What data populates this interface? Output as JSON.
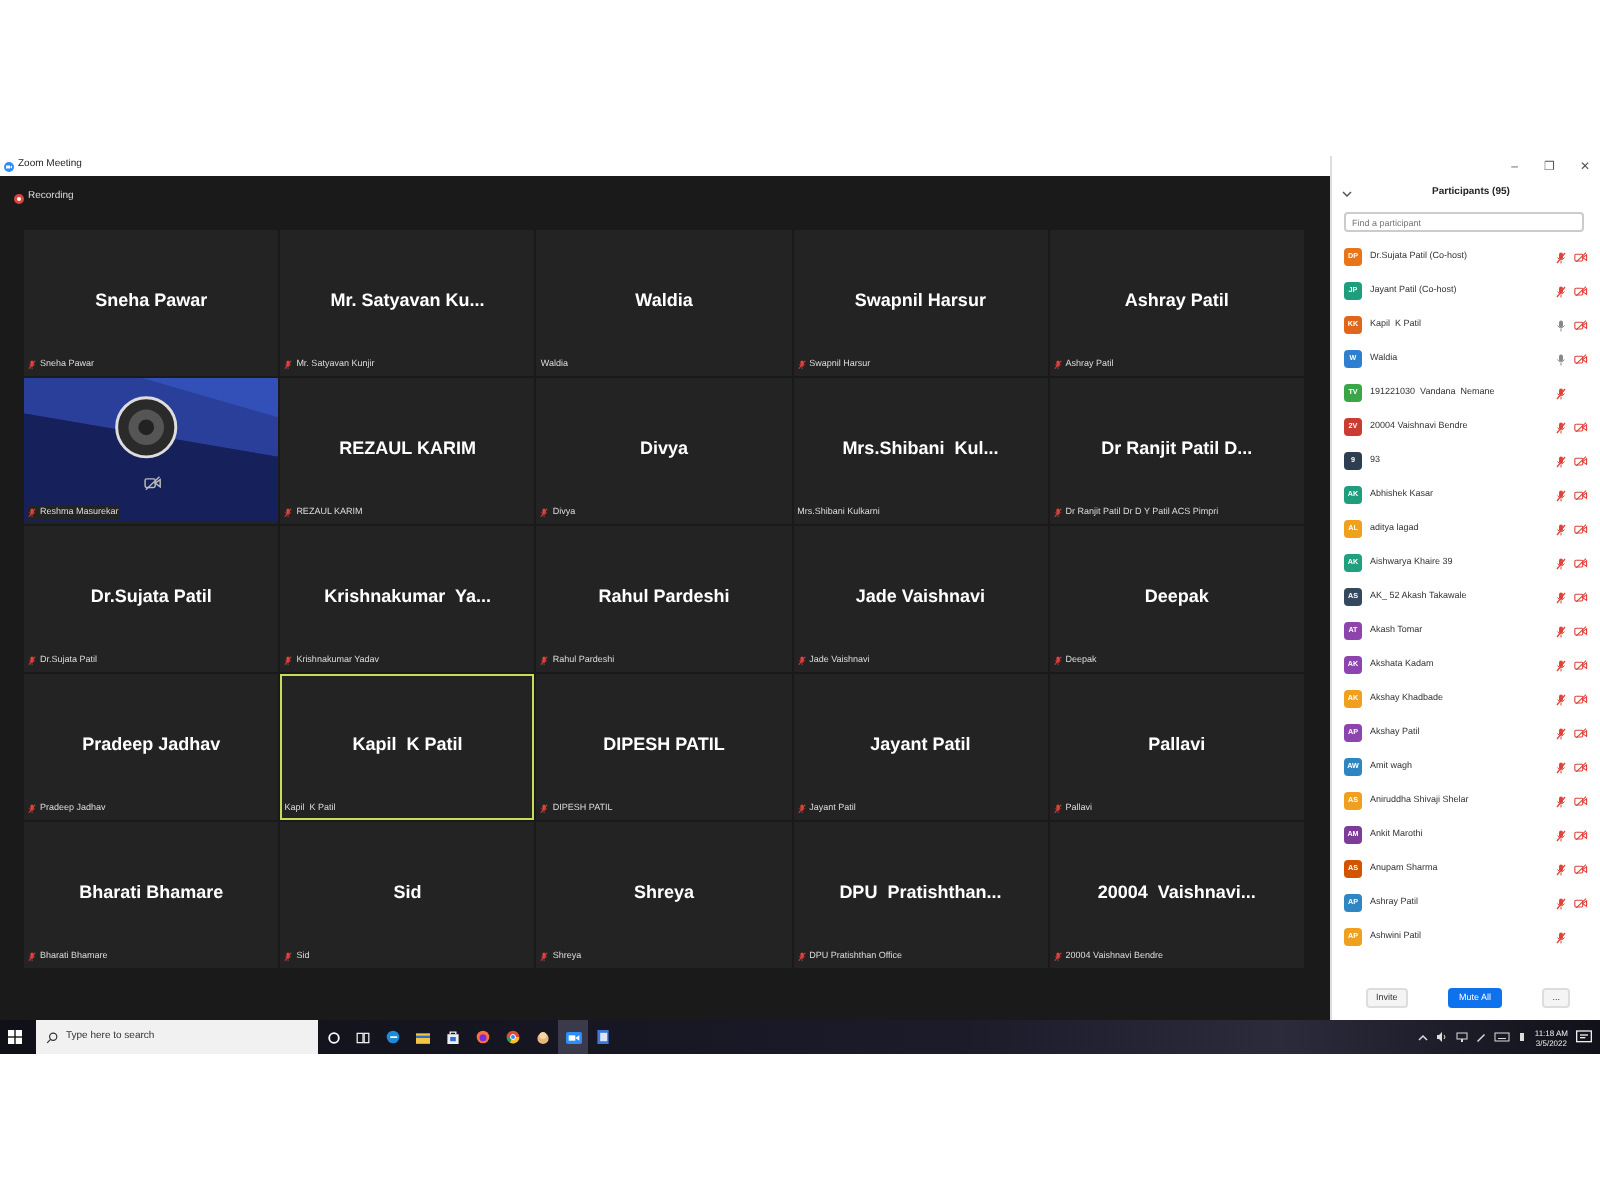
{
  "window": {
    "title": "Zoom Meeting",
    "controls": [
      "–",
      "❐",
      "✕"
    ]
  },
  "recording": {
    "label": "Recording"
  },
  "tiles": [
    {
      "name": "Sneha Pawar",
      "label": "Sneha Pawar",
      "muted": true,
      "active": false
    },
    {
      "name": "Mr. Satyavan Ku...",
      "label": "Mr. Satyavan Kunjir",
      "muted": true,
      "active": false
    },
    {
      "name": "Waldia",
      "label": "Waldia",
      "muted": false,
      "active": false
    },
    {
      "name": "Swapnil Harsur",
      "label": "Swapnil Harsur",
      "muted": true,
      "active": false
    },
    {
      "name": "Ashray Patil",
      "label": "Ashray Patil",
      "muted": true,
      "active": false
    },
    {
      "kind": "picture",
      "label": "Reshma Masurekar",
      "muted": true,
      "active": false,
      "camera_off": true
    },
    {
      "name": "REZAUL KARIM",
      "label": "REZAUL KARIM",
      "muted": true,
      "active": false
    },
    {
      "name": "Divya",
      "label": "Divya",
      "muted": true,
      "active": false
    },
    {
      "name": "Mrs.Shibani  Kul...",
      "label": "Mrs.Shibani Kulkarni",
      "muted": false,
      "active": false
    },
    {
      "name": "Dr Ranjit Patil D...",
      "label": "Dr Ranjit Patil Dr D Y Patil ACS Pimpri",
      "muted": true,
      "active": false
    },
    {
      "name": "Dr.Sujata Patil",
      "label": "Dr.Sujata Patil",
      "muted": true,
      "active": false
    },
    {
      "name": "Krishnakumar  Ya...",
      "label": "Krishnakumar Yadav",
      "muted": true,
      "active": false
    },
    {
      "name": "Rahul Pardeshi",
      "label": "Rahul Pardeshi",
      "muted": true,
      "active": false
    },
    {
      "name": "Jade Vaishnavi",
      "label": "Jade Vaishnavi",
      "muted": true,
      "active": false
    },
    {
      "name": "Deepak",
      "label": "Deepak",
      "muted": true,
      "active": false
    },
    {
      "name": "Pradeep Jadhav",
      "label": "Pradeep Jadhav",
      "muted": true,
      "active": false
    },
    {
      "name": "Kapil  K Patil",
      "label": "Kapil  K Patil",
      "muted": false,
      "active": true
    },
    {
      "name": "DIPESH PATIL",
      "label": "DIPESH PATIL",
      "muted": true,
      "active": false
    },
    {
      "name": "Jayant Patil",
      "label": "Jayant Patil",
      "muted": true,
      "active": false
    },
    {
      "name": "Pallavi",
      "label": "Pallavi",
      "muted": true,
      "active": false
    },
    {
      "name": "Bharati Bhamare",
      "label": "Bharati Bhamare",
      "muted": true,
      "active": false
    },
    {
      "name": "Sid",
      "label": "Sid",
      "muted": true,
      "active": false
    },
    {
      "name": "Shreya",
      "label": "Shreya",
      "muted": true,
      "active": false
    },
    {
      "name": "DPU  Pratishthan...",
      "label": "DPU Pratishthan Office",
      "muted": true,
      "active": false
    },
    {
      "name": "20004  Vaishnavi...",
      "label": "20004 Vaishnavi Bendre",
      "muted": true,
      "active": false
    }
  ],
  "participants_panel": {
    "title": "Participants (95)",
    "search": {
      "placeholder": "Find a participant"
    },
    "participants": [
      {
        "initials": "DP",
        "color": "#e8751a",
        "name": "Dr.Sujata Patil (Co-host)",
        "muted": true,
        "video_off": true
      },
      {
        "initials": "JP",
        "color": "#1f9e7d",
        "name": "Jayant Patil (Co-host)",
        "muted": true,
        "video_off": true
      },
      {
        "initials": "KK",
        "color": "#e0661c",
        "name": "Kapil  K Patil",
        "muted": false,
        "video_off": true
      },
      {
        "initials": "W",
        "color": "#2f7fd0",
        "name": "Waldia",
        "muted": false,
        "video_off": true
      },
      {
        "initials": "TV",
        "color": "#3aa648",
        "name": "191221030  Vandana  Nemane",
        "muted": true,
        "video_off": false
      },
      {
        "initials": "2V",
        "color": "#cc3b30",
        "name": "20004 Vaishnavi Bendre",
        "muted": true,
        "video_off": true
      },
      {
        "initials": "9",
        "color": "#2d3e50",
        "name": "93",
        "muted": true,
        "video_off": true
      },
      {
        "initials": "AK",
        "color": "#1f9e7d",
        "name": "Abhishek Kasar",
        "muted": true,
        "video_off": true
      },
      {
        "initials": "AL",
        "color": "#f0a01c",
        "name": "aditya lagad",
        "muted": true,
        "video_off": true
      },
      {
        "initials": "AK",
        "color": "#20a07e",
        "name": "Aishwarya Khaire 39",
        "muted": true,
        "video_off": true
      },
      {
        "initials": "AS",
        "color": "#34495e",
        "name": "AK_ 52 Akash Takawale",
        "muted": true,
        "video_off": true
      },
      {
        "initials": "AT",
        "color": "#8e44ad",
        "name": "Akash Tomar",
        "muted": true,
        "video_off": true
      },
      {
        "initials": "AK",
        "color": "#8e44ae",
        "name": "Akshata Kadam",
        "muted": true,
        "video_off": true
      },
      {
        "initials": "AK",
        "color": "#f0a01d",
        "name": "Akshay Khadbade",
        "muted": true,
        "video_off": true
      },
      {
        "initials": "AP",
        "color": "#8e44af",
        "name": "Akshay Patil",
        "muted": true,
        "video_off": true
      },
      {
        "initials": "AW",
        "color": "#2e86c1",
        "name": "Amit wagh",
        "muted": true,
        "video_off": true
      },
      {
        "initials": "AS",
        "color": "#f0a01e",
        "name": "Aniruddha Shivaji Shelar",
        "muted": true,
        "video_off": true
      },
      {
        "initials": "AM",
        "color": "#7d3c98",
        "name": "Ankit Marothi",
        "muted": true,
        "video_off": true
      },
      {
        "initials": "AS",
        "color": "#d35400",
        "name": "Anupam Sharma",
        "muted": true,
        "video_off": true
      },
      {
        "initials": "AP",
        "color": "#2e86c2",
        "name": "Ashray Patil",
        "muted": true,
        "video_off": true
      },
      {
        "initials": "AP",
        "color": "#f0a01f",
        "name": "Ashwini Patil",
        "muted": true,
        "video_off": false
      }
    ],
    "buttons": [
      "Invite",
      "Mute All",
      "..."
    ]
  },
  "taskbar": {
    "search": {
      "placeholder": "Type here to search"
    },
    "time": "11:18 AM",
    "date": "3/5/2022"
  }
}
